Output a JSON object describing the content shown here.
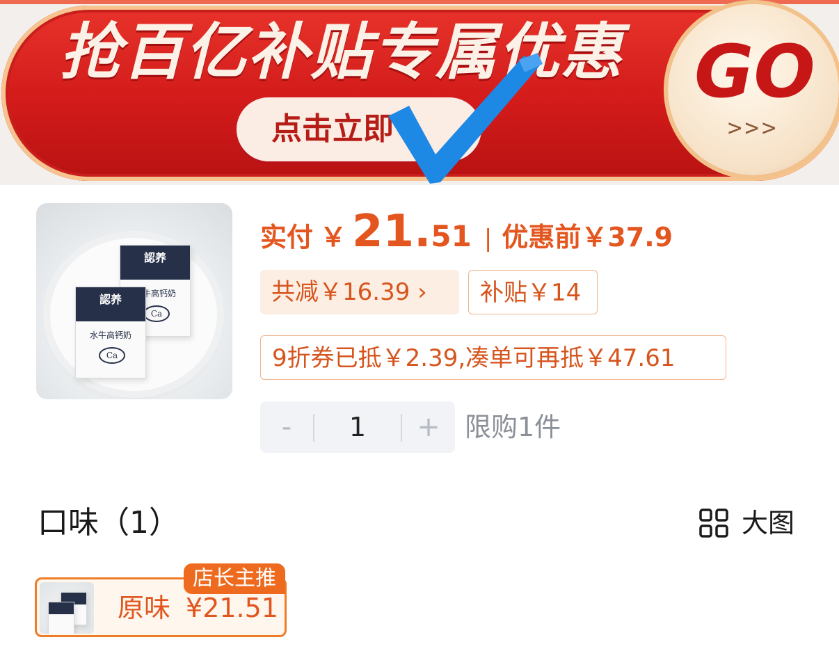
{
  "banner": {
    "title": "抢百亿补贴专属优惠",
    "cta": "点击立即",
    "go": "GO",
    "arrows": ">>>"
  },
  "product": {
    "image_text": {
      "brand": "認养",
      "name": "水牛高钙奶",
      "ca": "Ca"
    },
    "paid_label": "实付",
    "currency": "￥",
    "price_int": "21.",
    "price_dec": "51",
    "separator": "|",
    "before_label": "优惠前",
    "before_price": "￥37.9",
    "reduce_tag": "共减￥16.39 ›",
    "subsidy_tag": "补贴￥14",
    "coupon_tag": "9折券已抵￥2.39,凑单可再抵￥47.61",
    "quantity": {
      "minus": "-",
      "value": "1",
      "plus": "+",
      "limit": "限购1件"
    }
  },
  "flavor": {
    "title": "口味（1）",
    "big_view_label": "大图",
    "option": {
      "name": "原味",
      "price": "¥21.51",
      "badge": "店长主推"
    }
  },
  "colors": {
    "accent": "#e4561f",
    "banner_red": "#d21b1a",
    "option_border": "#ee7d2a",
    "check_blue": "#1e88e5"
  }
}
